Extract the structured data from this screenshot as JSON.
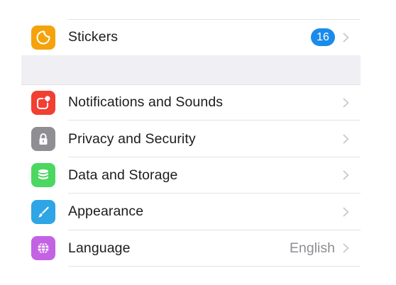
{
  "colors": {
    "stickers_icon": "#f4a30b",
    "notifications_icon": "#f13f32",
    "privacy_icon": "#8e8e93",
    "data_icon": "#4bd760",
    "appearance_icon": "#2ea5e5",
    "language_icon": "#c462e4",
    "badge": "#1a8bea",
    "separator_band": "#efeff4"
  },
  "top_section": {
    "stickers": {
      "label": "Stickers",
      "icon": "stickers-icon",
      "badge": "16"
    }
  },
  "settings": {
    "notifications": {
      "label": "Notifications and Sounds",
      "icon": "notification-icon"
    },
    "privacy": {
      "label": "Privacy and Security",
      "icon": "lock-icon"
    },
    "data": {
      "label": "Data and Storage",
      "icon": "database-icon"
    },
    "appearance": {
      "label": "Appearance",
      "icon": "brush-icon"
    },
    "language": {
      "label": "Language",
      "icon": "globe-icon",
      "value": "English"
    }
  }
}
